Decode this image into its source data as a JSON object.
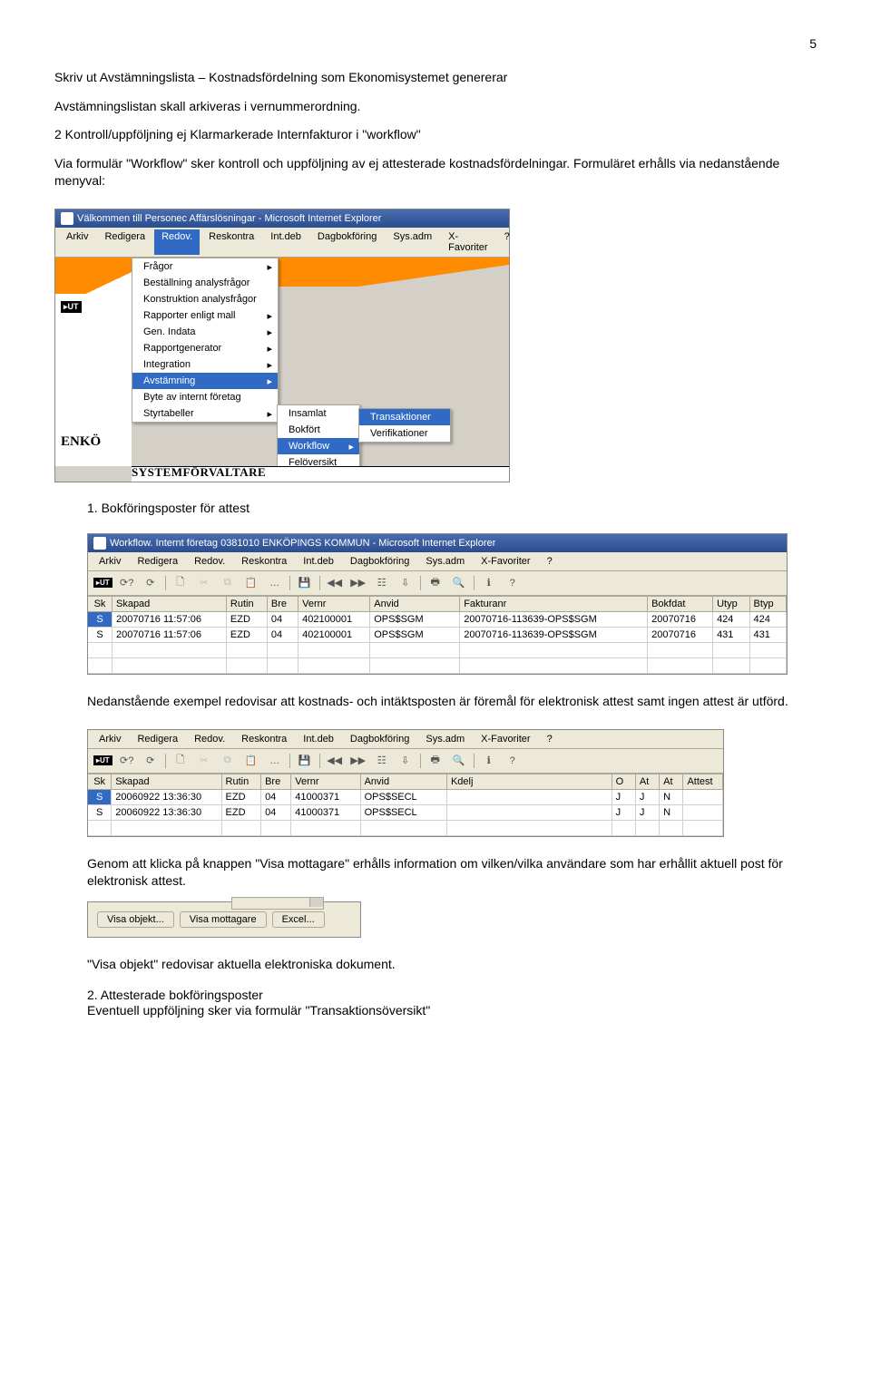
{
  "page_number": "5",
  "p1": "Skriv ut Avstämningslista – Kostnadsfördelning som Ekonomisystemet genererar",
  "p2": "Avstämningslistan skall arkiveras i vernummerordning.",
  "p3": "2 Kontroll/uppföljning ej Klarmarkerade Internfakturor i \"workflow\"",
  "p4": "Via formulär \"Workflow\" sker kontroll och uppföljning av ej attesterade kostnadsfördelningar. Formuläret erhålls via nedanstående menyval:",
  "ss1": {
    "title": "Välkommen till Personec Affärslösningar - Microsoft Internet Explorer",
    "menubar": [
      "Arkiv",
      "Redigera",
      "Redov.",
      "Reskontra",
      "Int.deb",
      "Dagbokföring",
      "Sys.adm",
      "X-Favoriter",
      "?"
    ],
    "menu1": [
      "Frågor",
      "Beställning analysfrågor",
      "Konstruktion analysfrågor",
      "Rapporter enligt mall",
      "Gen. Indata",
      "Rapportgenerator",
      "Integration",
      "Avstämning",
      "Byte av internt företag",
      "Styrtabeller"
    ],
    "menu2": [
      "Insamlat",
      "Bokfört",
      "Workflow",
      "Felöversikt"
    ],
    "menu3": [
      "Transaktioner",
      "Verifikationer"
    ],
    "enk": "ENKÖ",
    "sys": "SYSTEMFÖRVALTARE"
  },
  "item1": "1. Bokföringsposter för attest",
  "ss2": {
    "title": "Workflow. Internt företag 0381010 ENKÖPINGS KOMMUN - Microsoft Internet Explorer",
    "menubar": [
      "Arkiv",
      "Redigera",
      "Redov.",
      "Reskontra",
      "Int.deb",
      "Dagbokföring",
      "Sys.adm",
      "X-Favoriter",
      "?"
    ],
    "headers": [
      "Sk",
      "Skapad",
      "Rutin",
      "Bre",
      "Vernr",
      "Anvid",
      "Fakturanr",
      "Bokfdat",
      "Utyp",
      "Btyp"
    ],
    "rows": [
      [
        "S",
        "20070716 11:57:06",
        "EZD",
        "04",
        "402100001",
        "OPS$SGM",
        "20070716-113639-OPS$SGM",
        "20070716",
        "424",
        "424"
      ],
      [
        "S",
        "20070716 11:57:06",
        "EZD",
        "04",
        "402100001",
        "OPS$SGM",
        "20070716-113639-OPS$SGM",
        "20070716",
        "431",
        "431"
      ]
    ]
  },
  "p5": "Nedanstående exempel redovisar att kostnads- och intäktsposten är föremål för elektronisk attest samt ingen attest är utförd.",
  "ss3": {
    "menubar": [
      "Arkiv",
      "Redigera",
      "Redov.",
      "Reskontra",
      "Int.deb",
      "Dagbokföring",
      "Sys.adm",
      "X-Favoriter",
      "?"
    ],
    "headers": [
      "Sk",
      "Skapad",
      "Rutin",
      "Bre",
      "Vernr",
      "Anvid",
      "Kdelj",
      "O",
      "At",
      "At",
      "Attest"
    ],
    "rows": [
      [
        "S",
        "20060922 13:36:30",
        "EZD",
        "04",
        "41000371",
        "OPS$SECL",
        "",
        "J",
        "J",
        "N",
        ""
      ],
      [
        "S",
        "20060922 13:36:30",
        "EZD",
        "04",
        "41000371",
        "OPS$SECL",
        "",
        "J",
        "J",
        "N",
        ""
      ]
    ]
  },
  "p6": "Genom att klicka på knappen \"Visa mottagare\" erhålls information om vilken/vilka användare som har erhållit aktuell post för elektronisk attest.",
  "ss4": {
    "btn1": "Visa objekt...",
    "btn2": "Visa mottagare",
    "btn3": "Excel..."
  },
  "p7": "\"Visa objekt\" redovisar aktuella elektroniska dokument.",
  "item2": "2. Attesterade bokföringsposter",
  "p8": "Eventuell uppföljning sker via formulär \"Transaktionsöversikt\""
}
